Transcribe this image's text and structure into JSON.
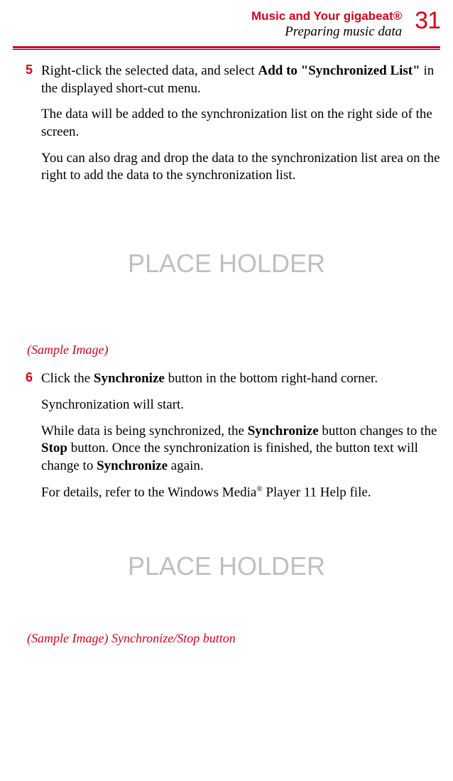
{
  "header": {
    "title": "Music and Your gigabeat®",
    "subtitle": "Preparing music data",
    "page_number": "31"
  },
  "steps": {
    "s5": {
      "num": "5",
      "p1_a": "Right-click the selected data, and select ",
      "p1_b": "Add to \"Synchronized List\"",
      "p1_c": " in the displayed short-cut menu.",
      "p2": "The data will be added to the synchronization list on the right side of the screen.",
      "p3": "You can also drag and drop the data to the synchronization list area on the right to add the data to the synchronization list."
    },
    "s6": {
      "num": "6",
      "p1_a": "Click the ",
      "p1_b": "Synchronize",
      "p1_c": " button in the bottom right-hand corner.",
      "p2": "Synchronization will start.",
      "p3_a": "While data is being synchronized, the ",
      "p3_b": "Synchronize",
      "p3_c": " button changes to the ",
      "p3_d": "Stop",
      "p3_e": " button. Once the synchronization is finished, the button text will change to ",
      "p3_f": "Synchronize",
      "p3_g": " again.",
      "p4_a": "For details, refer to the Windows Media",
      "p4_b": "®",
      "p4_c": " Player 11 Help file."
    }
  },
  "placeholder1": "PLACE HOLDER",
  "placeholder2": "PLACE HOLDER",
  "caption1": "(Sample Image)",
  "caption2": "(Sample Image) Synchronize/Stop button"
}
